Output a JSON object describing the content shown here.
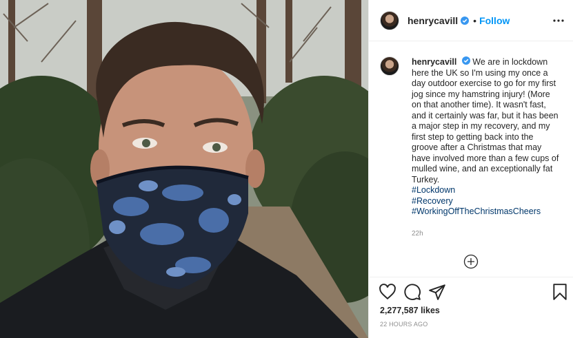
{
  "post": {
    "image_alt": "Selfie of man wearing blue camouflage face mask in a wooded path"
  },
  "header": {
    "username": "henrycavill",
    "dot": "•",
    "follow_label": "Follow",
    "more_icon": "more-horizontal-icon"
  },
  "caption": {
    "username": "henrycavill",
    "text": "We are in lockdown here the UK so I'm using my once a day outdoor exercise to go for my first jog since my hamstring injury! (More on that another time). It wasn't fast, and it certainly was far, but it has been a major step in my recovery, and my first step to getting back into the groove after a Christmas that may have involved more than a few cups of mulled wine, and an exceptionally fat Turkey.",
    "hashtags": [
      "#Lockdown",
      "#Recovery",
      "#WorkingOffTheChristmasCheers"
    ],
    "time": "22h"
  },
  "actions": {
    "like_icon": "heart-icon",
    "comment_icon": "comment-icon",
    "share_icon": "share-icon",
    "save_icon": "bookmark-icon",
    "likes": "2,277,587 likes",
    "posted": "22 HOURS AGO"
  },
  "colors": {
    "link": "#0095f6",
    "hashtag": "#00376b",
    "verified": "#3897f0"
  }
}
